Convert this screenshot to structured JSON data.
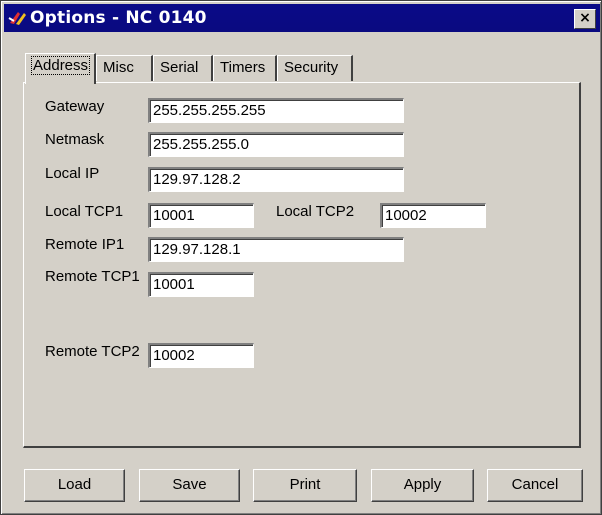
{
  "window": {
    "title": "Options - NC 0140",
    "close_glyph": "×"
  },
  "tabs": [
    {
      "label": "Address",
      "active": true
    },
    {
      "label": "Misc"
    },
    {
      "label": "Serial"
    },
    {
      "label": "Timers"
    },
    {
      "label": "Security"
    }
  ],
  "address": {
    "gateway_label": "Gateway",
    "gateway_value": "255.255.255.255",
    "netmask_label": "Netmask",
    "netmask_value": "255.255.255.0",
    "local_ip_label": "Local IP",
    "local_ip_value": "129.97.128.2",
    "local_tcp1_label": "Local TCP1",
    "local_tcp1_value": "10001",
    "local_tcp2_label": "Local TCP2",
    "local_tcp2_value": "10002",
    "remote_ip1_label": "Remote IP1",
    "remote_ip1_value": "129.97.128.1",
    "remote_tcp1_label": "Remote TCP1",
    "remote_tcp1_value": "10001",
    "remote_tcp2_label": "Remote TCP2",
    "remote_tcp2_value": "10002"
  },
  "buttons": {
    "load": "Load",
    "save": "Save",
    "print": "Print",
    "apply": "Apply",
    "cancel": "Cancel"
  },
  "colors": {
    "title_bar": "#0a0a80",
    "face": "#d4d0c8"
  }
}
